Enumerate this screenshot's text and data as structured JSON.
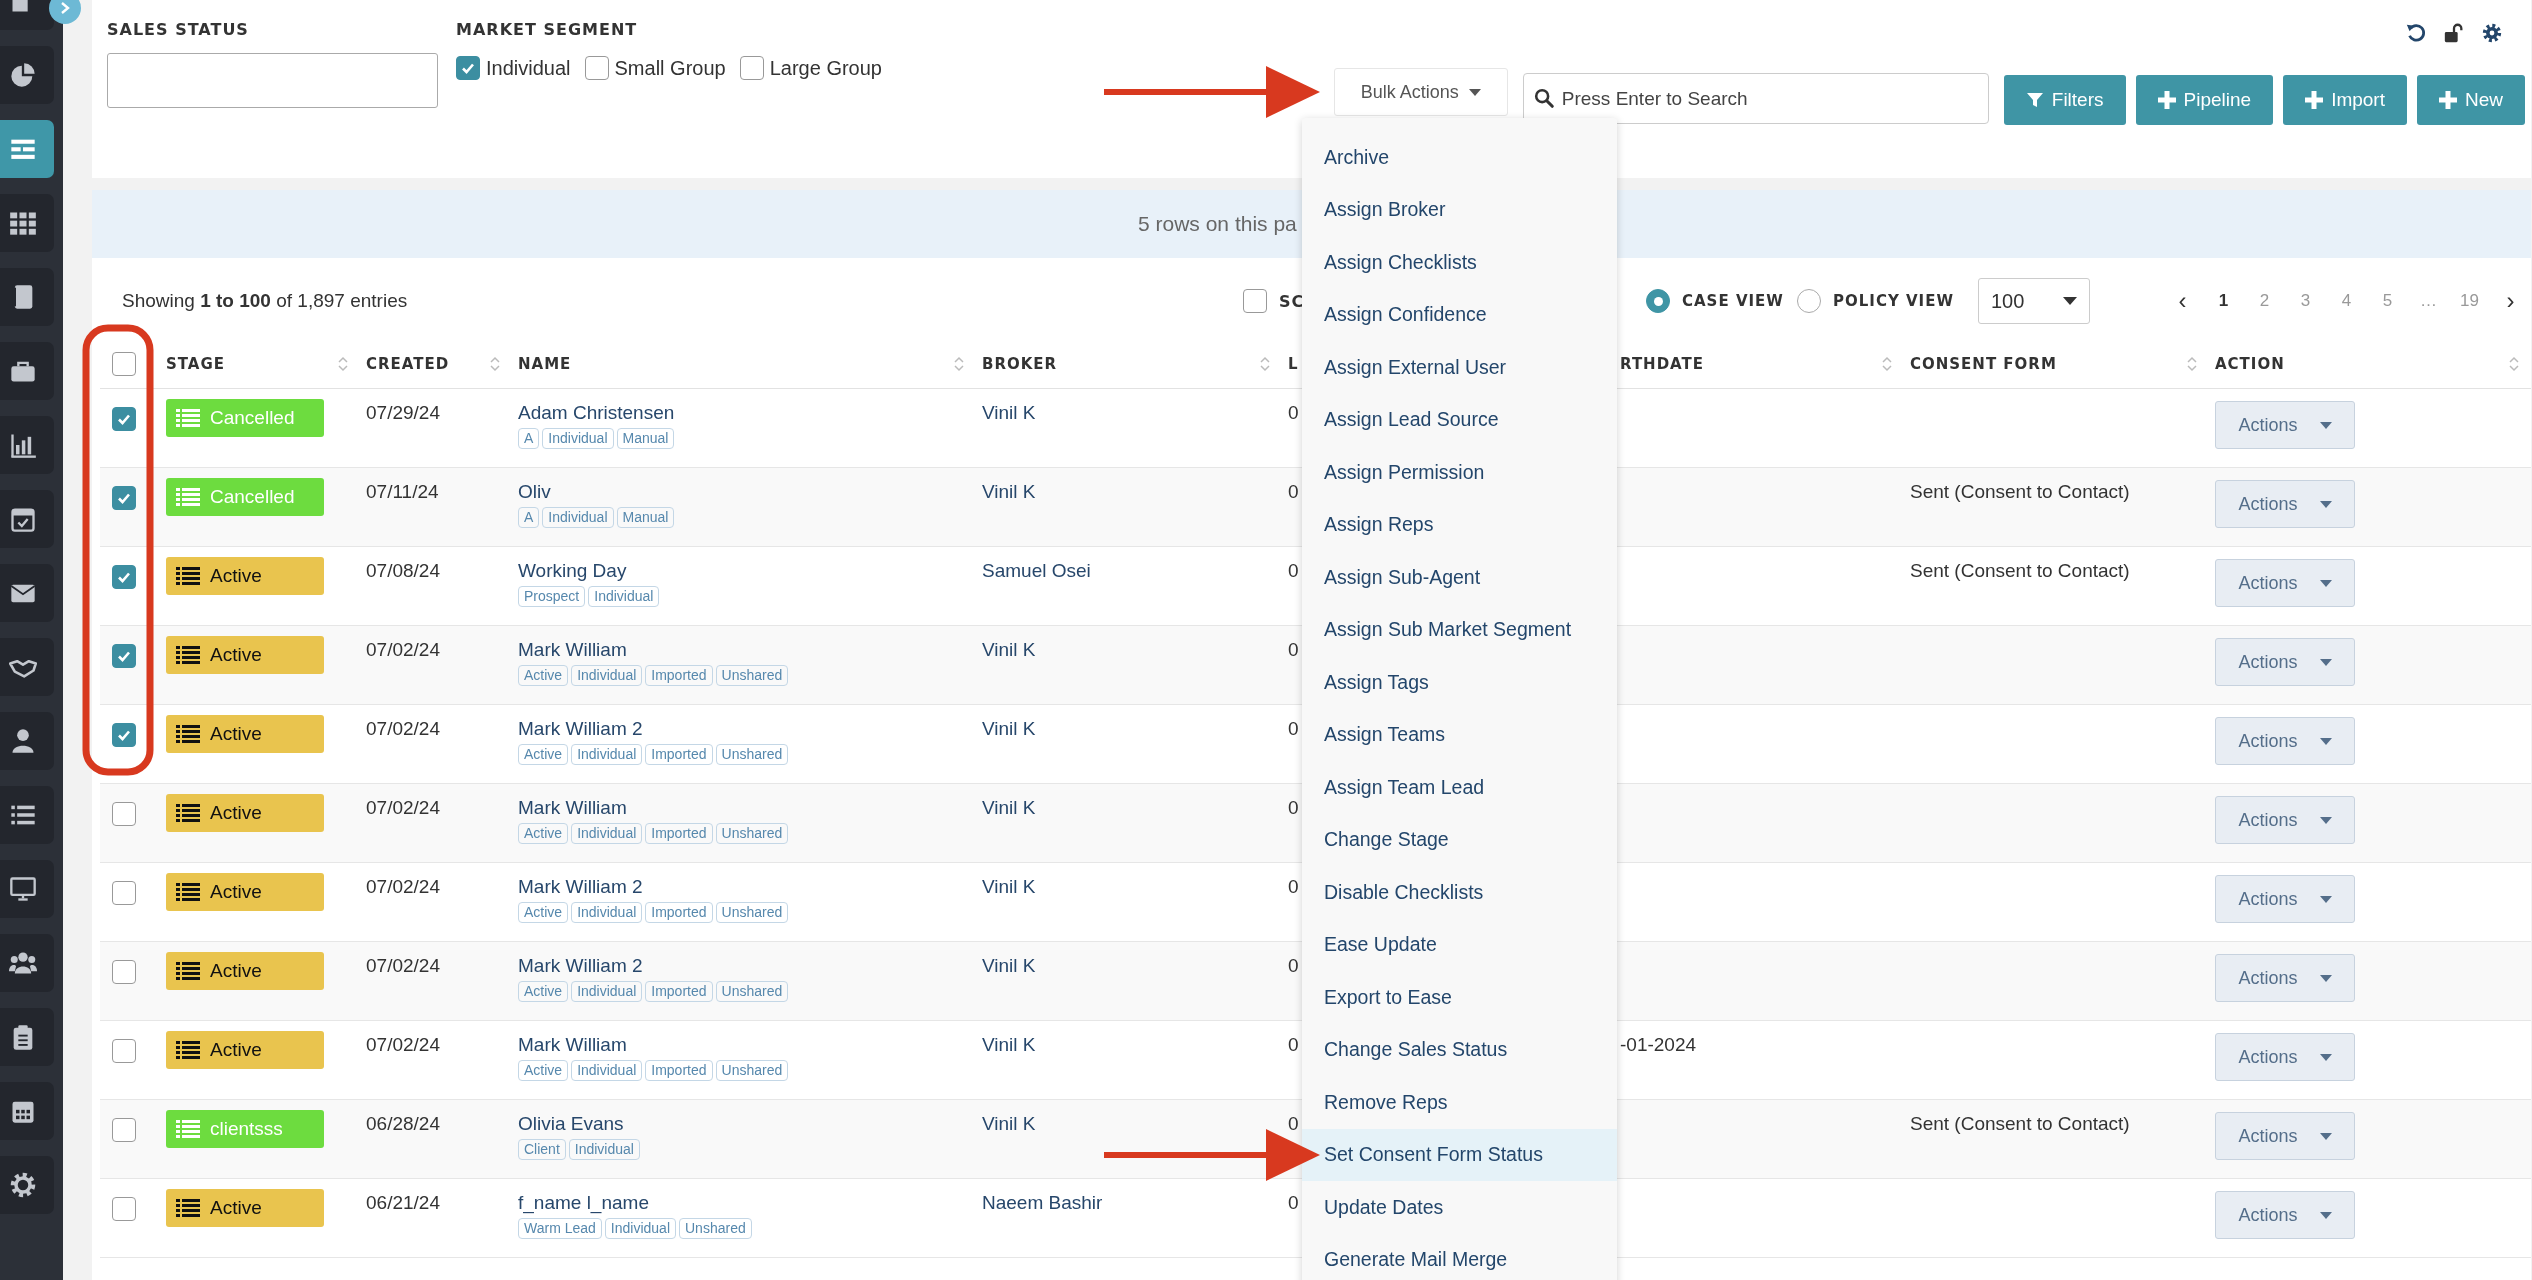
{
  "sidebar": {
    "items": [
      {
        "selected": false
      },
      {
        "selected": false
      },
      {
        "selected": true
      },
      {
        "selected": false
      },
      {
        "selected": false
      },
      {
        "selected": false
      },
      {
        "selected": false
      },
      {
        "selected": false
      },
      {
        "selected": false
      },
      {
        "selected": false
      },
      {
        "selected": false
      },
      {
        "selected": false
      },
      {
        "selected": false
      },
      {
        "selected": false
      },
      {
        "selected": false
      },
      {
        "selected": false
      },
      {
        "selected": false
      }
    ]
  },
  "filters": {
    "sales_status": {
      "label": "SALES STATUS"
    },
    "market_segment": {
      "label": "MARKET SEGMENT",
      "options": [
        {
          "label": "Individual",
          "checked": true
        },
        {
          "label": "Small Group",
          "checked": false
        },
        {
          "label": "Large Group",
          "checked": false
        }
      ]
    }
  },
  "bulk_actions": {
    "label": "Bulk Actions",
    "expanded": true,
    "items": [
      {
        "label": "Archive",
        "selected": false
      },
      {
        "label": "Assign Broker",
        "selected": false
      },
      {
        "label": "Assign Checklists",
        "selected": false
      },
      {
        "label": "Assign Confidence",
        "selected": false
      },
      {
        "label": "Assign External User",
        "selected": false
      },
      {
        "label": "Assign Lead Source",
        "selected": false
      },
      {
        "label": "Assign Permission",
        "selected": false
      },
      {
        "label": "Assign Reps",
        "selected": false
      },
      {
        "label": "Assign Sub-Agent",
        "selected": false
      },
      {
        "label": "Assign Sub Market Segment",
        "selected": false
      },
      {
        "label": "Assign Tags",
        "selected": false
      },
      {
        "label": "Assign Teams",
        "selected": false
      },
      {
        "label": "Assign Team Lead",
        "selected": false
      },
      {
        "label": "Change Stage",
        "selected": false
      },
      {
        "label": "Disable Checklists",
        "selected": false
      },
      {
        "label": "Ease Update",
        "selected": false
      },
      {
        "label": "Export to Ease",
        "selected": false
      },
      {
        "label": "Change Sales Status",
        "selected": false
      },
      {
        "label": "Remove Reps",
        "selected": false
      },
      {
        "label": "Set Consent Form Status",
        "selected": true
      },
      {
        "label": "Update Dates",
        "selected": false
      },
      {
        "label": "Generate Mail Merge",
        "selected": false
      }
    ]
  },
  "search": {
    "placeholder": "Press Enter to Search"
  },
  "buttons": [
    {
      "label": "Filters",
      "kind": "filter"
    },
    {
      "label": "Pipeline",
      "kind": "add"
    },
    {
      "label": "Import",
      "kind": "add"
    },
    {
      "label": "New",
      "kind": "add"
    }
  ],
  "banner": "5 rows on this pa",
  "summary": "Showing **1 to 100** of 1,897 entries",
  "select_option": {
    "label": "SC",
    "checked": false
  },
  "views": [
    {
      "label": "CASE VIEW",
      "selected": true
    },
    {
      "label": "POLICY VIEW",
      "selected": false
    }
  ],
  "page_size": "100",
  "pagination": [
    {
      "label": "‹",
      "kind": "arrow"
    },
    {
      "label": "1",
      "kind": "page",
      "selected": true
    },
    {
      "label": "2",
      "kind": "page",
      "selected": false
    },
    {
      "label": "3",
      "kind": "page",
      "selected": false
    },
    {
      "label": "4",
      "kind": "page",
      "selected": false
    },
    {
      "label": "5",
      "kind": "page",
      "selected": false
    },
    {
      "label": "…",
      "kind": "gap"
    },
    {
      "label": "19",
      "kind": "page",
      "selected": false
    },
    {
      "label": "›",
      "kind": "arrow"
    }
  ],
  "table": {
    "select_all": false,
    "columns": [
      {
        "label": "STAGE",
        "sortable": true
      },
      {
        "label": "CREATED",
        "sortable": true
      },
      {
        "label": "NAME",
        "sortable": true
      },
      {
        "label": "BROKER",
        "sortable": true
      },
      {
        "label": "L",
        "sortable": false
      },
      {
        "label": "RTHDATE",
        "sortable": true
      },
      {
        "label": "CONSENT FORM",
        "sortable": true
      },
      {
        "label": "ACTION",
        "sortable": true
      }
    ],
    "rows": [
      {
        "checked": true,
        "stage": {
          "label": "Cancelled",
          "color": "#6ddc3f"
        },
        "created": "07/29/24",
        "name": "Adam Christensen",
        "tags": [
          "A",
          "Individual",
          "Manual"
        ],
        "broker": "Vinil K",
        "column_5": "0",
        "action": "Actions"
      },
      {
        "checked": true,
        "stage": {
          "label": "Cancelled",
          "color": "#6ddc3f"
        },
        "created": "07/11/24",
        "name": "Oliv",
        "tags": [
          "A",
          "Individual",
          "Manual"
        ],
        "broker": "Vinil K",
        "column_5": "0",
        "consent_form": "Sent (Consent to Contact)",
        "action": "Actions"
      },
      {
        "checked": true,
        "stage": {
          "label": "Active",
          "color": "#e9c44e"
        },
        "created": "07/08/24",
        "name": "Working Day",
        "tags": [
          "Prospect",
          "Individual"
        ],
        "broker": "Samuel Osei",
        "column_5": "0",
        "consent_form": "Sent (Consent to Contact)",
        "action": "Actions"
      },
      {
        "checked": true,
        "stage": {
          "label": "Active",
          "color": "#e9c44e"
        },
        "created": "07/02/24",
        "name": "Mark William",
        "tags": [
          "Active",
          "Individual",
          "Imported",
          "Unshared"
        ],
        "broker": "Vinil K",
        "column_5": "0",
        "action": "Actions"
      },
      {
        "checked": true,
        "stage": {
          "label": "Active",
          "color": "#e9c44e"
        },
        "created": "07/02/24",
        "name": "Mark William 2",
        "tags": [
          "Active",
          "Individual",
          "Imported",
          "Unshared"
        ],
        "broker": "Vinil K",
        "column_5": "0",
        "action": "Actions"
      },
      {
        "checked": false,
        "stage": {
          "label": "Active",
          "color": "#e9c44e"
        },
        "created": "07/02/24",
        "name": "Mark William",
        "tags": [
          "Active",
          "Individual",
          "Imported",
          "Unshared"
        ],
        "broker": "Vinil K",
        "column_5": "0",
        "action": "Actions"
      },
      {
        "checked": false,
        "stage": {
          "label": "Active",
          "color": "#e9c44e"
        },
        "created": "07/02/24",
        "name": "Mark William 2",
        "tags": [
          "Active",
          "Individual",
          "Imported",
          "Unshared"
        ],
        "broker": "Vinil K",
        "column_5": "0",
        "action": "Actions"
      },
      {
        "checked": false,
        "stage": {
          "label": "Active",
          "color": "#e9c44e"
        },
        "created": "07/02/24",
        "name": "Mark William 2",
        "tags": [
          "Active",
          "Individual",
          "Imported",
          "Unshared"
        ],
        "broker": "Vinil K",
        "column_5": "0",
        "action": "Actions"
      },
      {
        "checked": false,
        "stage": {
          "label": "Active",
          "color": "#e9c44e"
        },
        "created": "07/02/24",
        "name": "Mark William",
        "tags": [
          "Active",
          "Individual",
          "Imported",
          "Unshared"
        ],
        "broker": "Vinil K",
        "column_5": "0",
        "birthdate": "-01-2024",
        "action": "Actions"
      },
      {
        "checked": false,
        "stage": {
          "label": "clientsss",
          "color": "#6ddc3f"
        },
        "created": "06/28/24",
        "name": "Olivia Evans",
        "tags": [
          "Client",
          "Individual"
        ],
        "broker": "Vinil K",
        "column_5": "0",
        "consent_form": "Sent (Consent to Contact)",
        "action": "Actions"
      },
      {
        "checked": false,
        "stage": {
          "label": "Active",
          "color": "#e9c44e"
        },
        "created": "06/21/24",
        "name": "f_name l_name",
        "tags": [
          "Warm Lead",
          "Individual",
          "Unshared"
        ],
        "broker": "Naeem Bashir",
        "column_5": "0",
        "action": "Actions"
      }
    ]
  },
  "annotations": [
    {
      "kind": "arrow"
    },
    {
      "kind": "arrow"
    },
    {
      "kind": "outline"
    }
  ]
}
